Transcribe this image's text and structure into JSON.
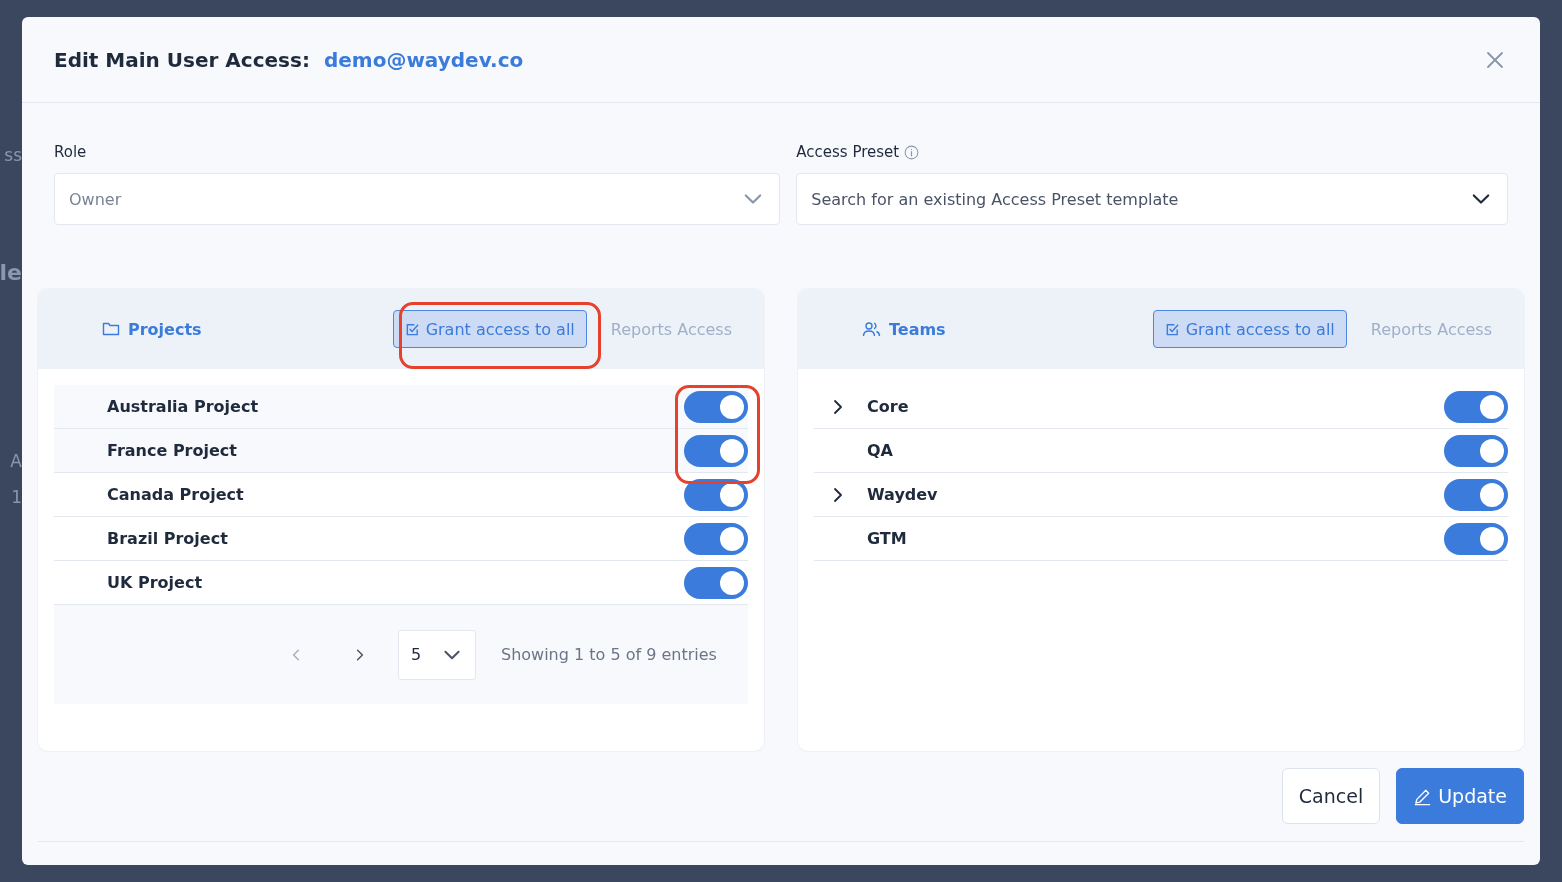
{
  "backdrop": {
    "fragments": [
      "ss",
      "le",
      "A",
      "1"
    ]
  },
  "dialog": {
    "title": "Edit Main User Access:",
    "email": "demo@waydev.co"
  },
  "role": {
    "label": "Role",
    "value": "Owner"
  },
  "access_preset": {
    "label": "Access Preset",
    "placeholder": "Search for an existing Access Preset template"
  },
  "projects": {
    "title": "Projects",
    "grant_button": "Grant access to all",
    "reports_label": "Reports Access",
    "rows": [
      {
        "name": "Australia Project",
        "on": true
      },
      {
        "name": "France Project",
        "on": true
      },
      {
        "name": "Canada Project",
        "on": true
      },
      {
        "name": "Brazil Project",
        "on": true
      },
      {
        "name": "UK Project",
        "on": true
      }
    ],
    "pagination": {
      "page_size": "5",
      "summary": "Showing 1 to 5 of 9 entries"
    }
  },
  "teams": {
    "title": "Teams",
    "grant_button": "Grant access to all",
    "reports_label": "Reports Access",
    "rows": [
      {
        "name": "Core",
        "expandable": true,
        "on": true
      },
      {
        "name": "QA",
        "expandable": false,
        "on": true
      },
      {
        "name": "Waydev",
        "expandable": true,
        "on": true
      },
      {
        "name": "GTM",
        "expandable": false,
        "on": true
      }
    ]
  },
  "buttons": {
    "cancel": "Cancel",
    "update": "Update"
  }
}
